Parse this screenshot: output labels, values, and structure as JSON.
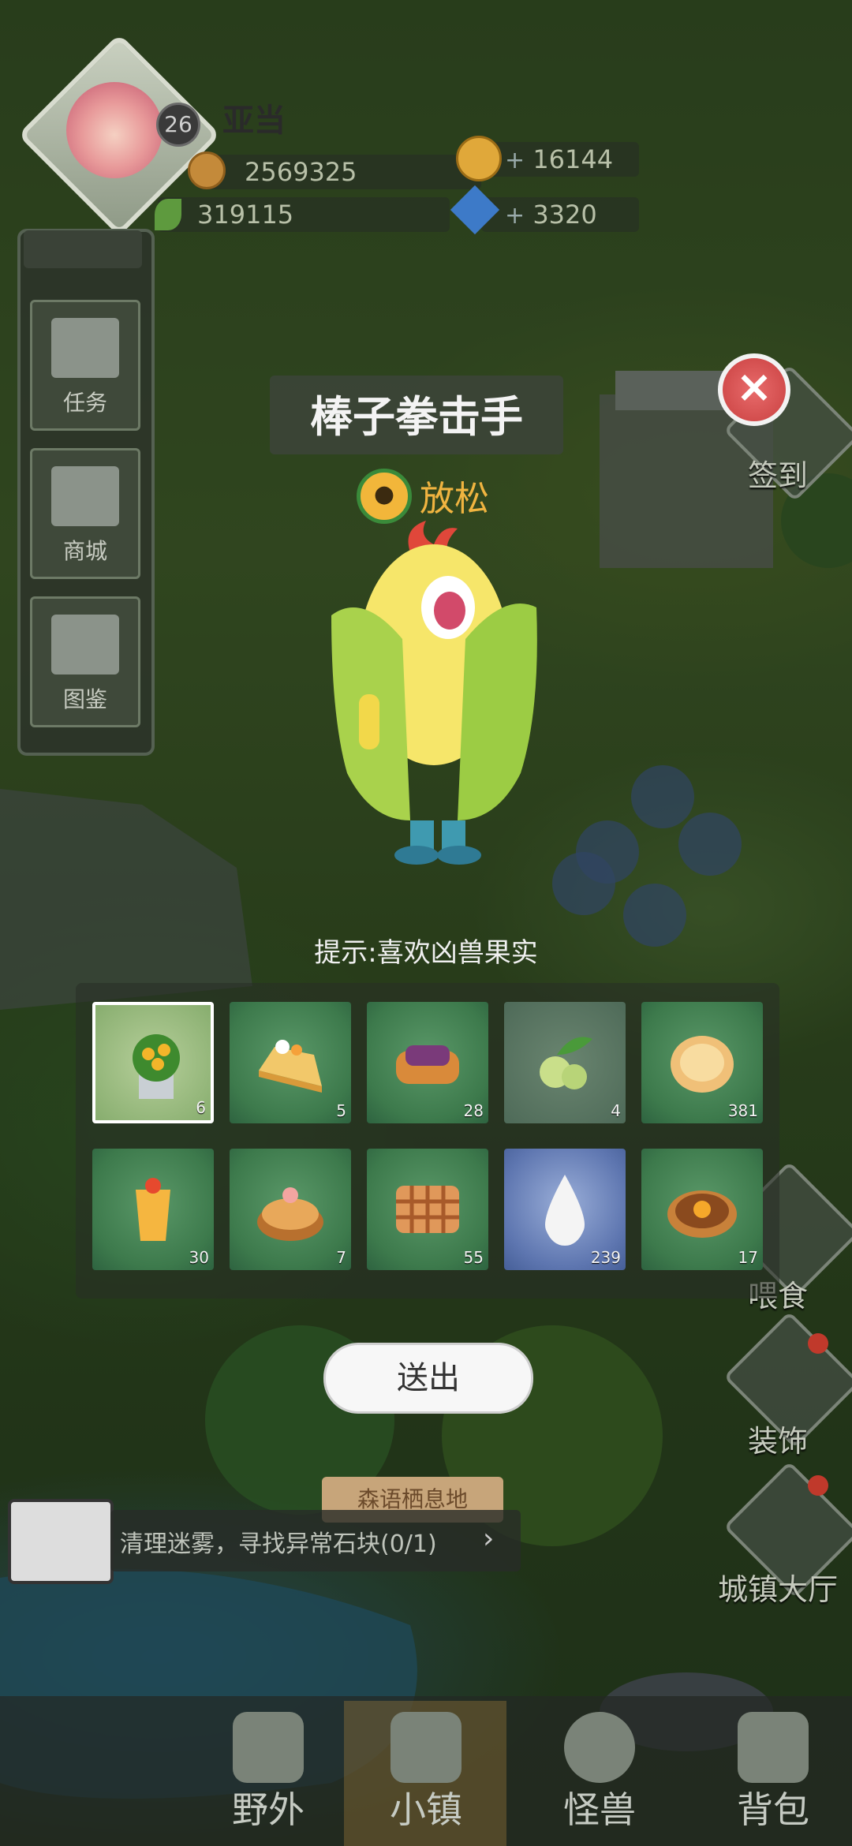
{
  "player": {
    "name": "亚当",
    "level": "26",
    "gold": "2569325",
    "leaf": "319115",
    "coins": "16144",
    "gems": "3320"
  },
  "menu": [
    {
      "label": "任务"
    },
    {
      "label": "商城"
    },
    {
      "label": "图鉴"
    }
  ],
  "side": {
    "checkin": "签到",
    "feed": "喂食",
    "decorate": "装饰",
    "town_hall": "城镇大厅"
  },
  "popup": {
    "monster_name": "棒子拳击手",
    "mood": "放松",
    "hint": "提示:喜欢凶兽果实",
    "send_label": "送出",
    "foods": [
      {
        "name": "flower-pot",
        "qty": "6",
        "selected": true
      },
      {
        "name": "cake-slice",
        "qty": "5"
      },
      {
        "name": "bread-loaf",
        "qty": "28"
      },
      {
        "name": "green-fruit",
        "qty": "4"
      },
      {
        "name": "pancake",
        "qty": "381"
      },
      {
        "name": "juice-cup",
        "qty": "30"
      },
      {
        "name": "fruit-tart",
        "qty": "7"
      },
      {
        "name": "lattice-pie",
        "qty": "55"
      },
      {
        "name": "milk-drop",
        "qty": "239"
      },
      {
        "name": "pumpkin-pie",
        "qty": "17"
      }
    ]
  },
  "quest": {
    "text": "清理迷雾，寻找异常石块(0/1)",
    "area": "森语栖息地"
  },
  "nav": [
    {
      "label": "野外"
    },
    {
      "label": "小镇"
    },
    {
      "label": "怪兽"
    },
    {
      "label": "背包"
    }
  ]
}
